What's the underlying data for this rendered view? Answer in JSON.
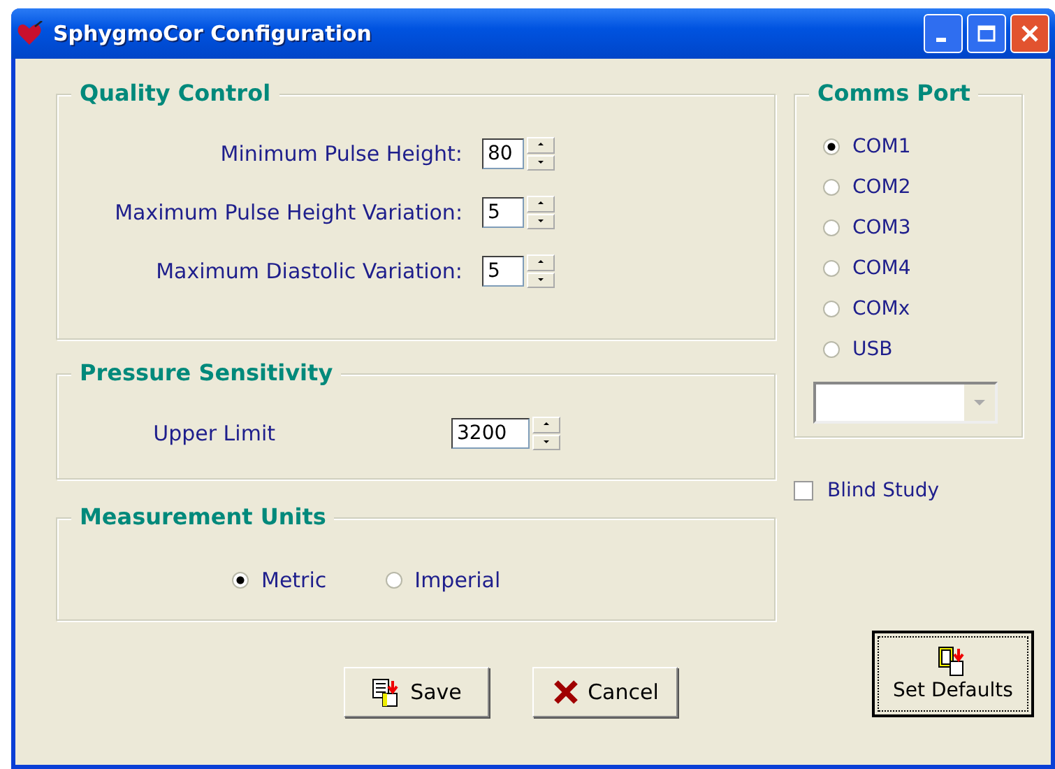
{
  "window": {
    "title": "SphygmoCor Configuration"
  },
  "quality_control": {
    "title": "Quality Control",
    "fields": [
      {
        "label": "Minimum Pulse Height:",
        "value": "80"
      },
      {
        "label": "Maximum Pulse Height Variation:",
        "value": "5"
      },
      {
        "label": "Maximum Diastolic Variation:",
        "value": "5"
      }
    ]
  },
  "pressure_sensitivity": {
    "title": "Pressure Sensitivity",
    "fields": [
      {
        "label": "Upper Limit",
        "value": "3200"
      }
    ]
  },
  "measurement_units": {
    "title": "Measurement Units",
    "options": [
      {
        "label": "Metric",
        "selected": true
      },
      {
        "label": "Imperial",
        "selected": false
      }
    ]
  },
  "comms_port": {
    "title": "Comms Port",
    "options": [
      {
        "label": "COM1",
        "selected": true
      },
      {
        "label": "COM2",
        "selected": false
      },
      {
        "label": "COM3",
        "selected": false
      },
      {
        "label": "COM4",
        "selected": false
      },
      {
        "label": "COMx",
        "selected": false
      },
      {
        "label": "USB",
        "selected": false
      }
    ]
  },
  "blind_study": {
    "label": "Blind Study",
    "checked": false
  },
  "buttons": [
    {
      "kind": "save",
      "label": "Save"
    },
    {
      "kind": "cancel",
      "label": "Cancel"
    }
  ],
  "set_defaults": {
    "label": "Set Defaults"
  }
}
